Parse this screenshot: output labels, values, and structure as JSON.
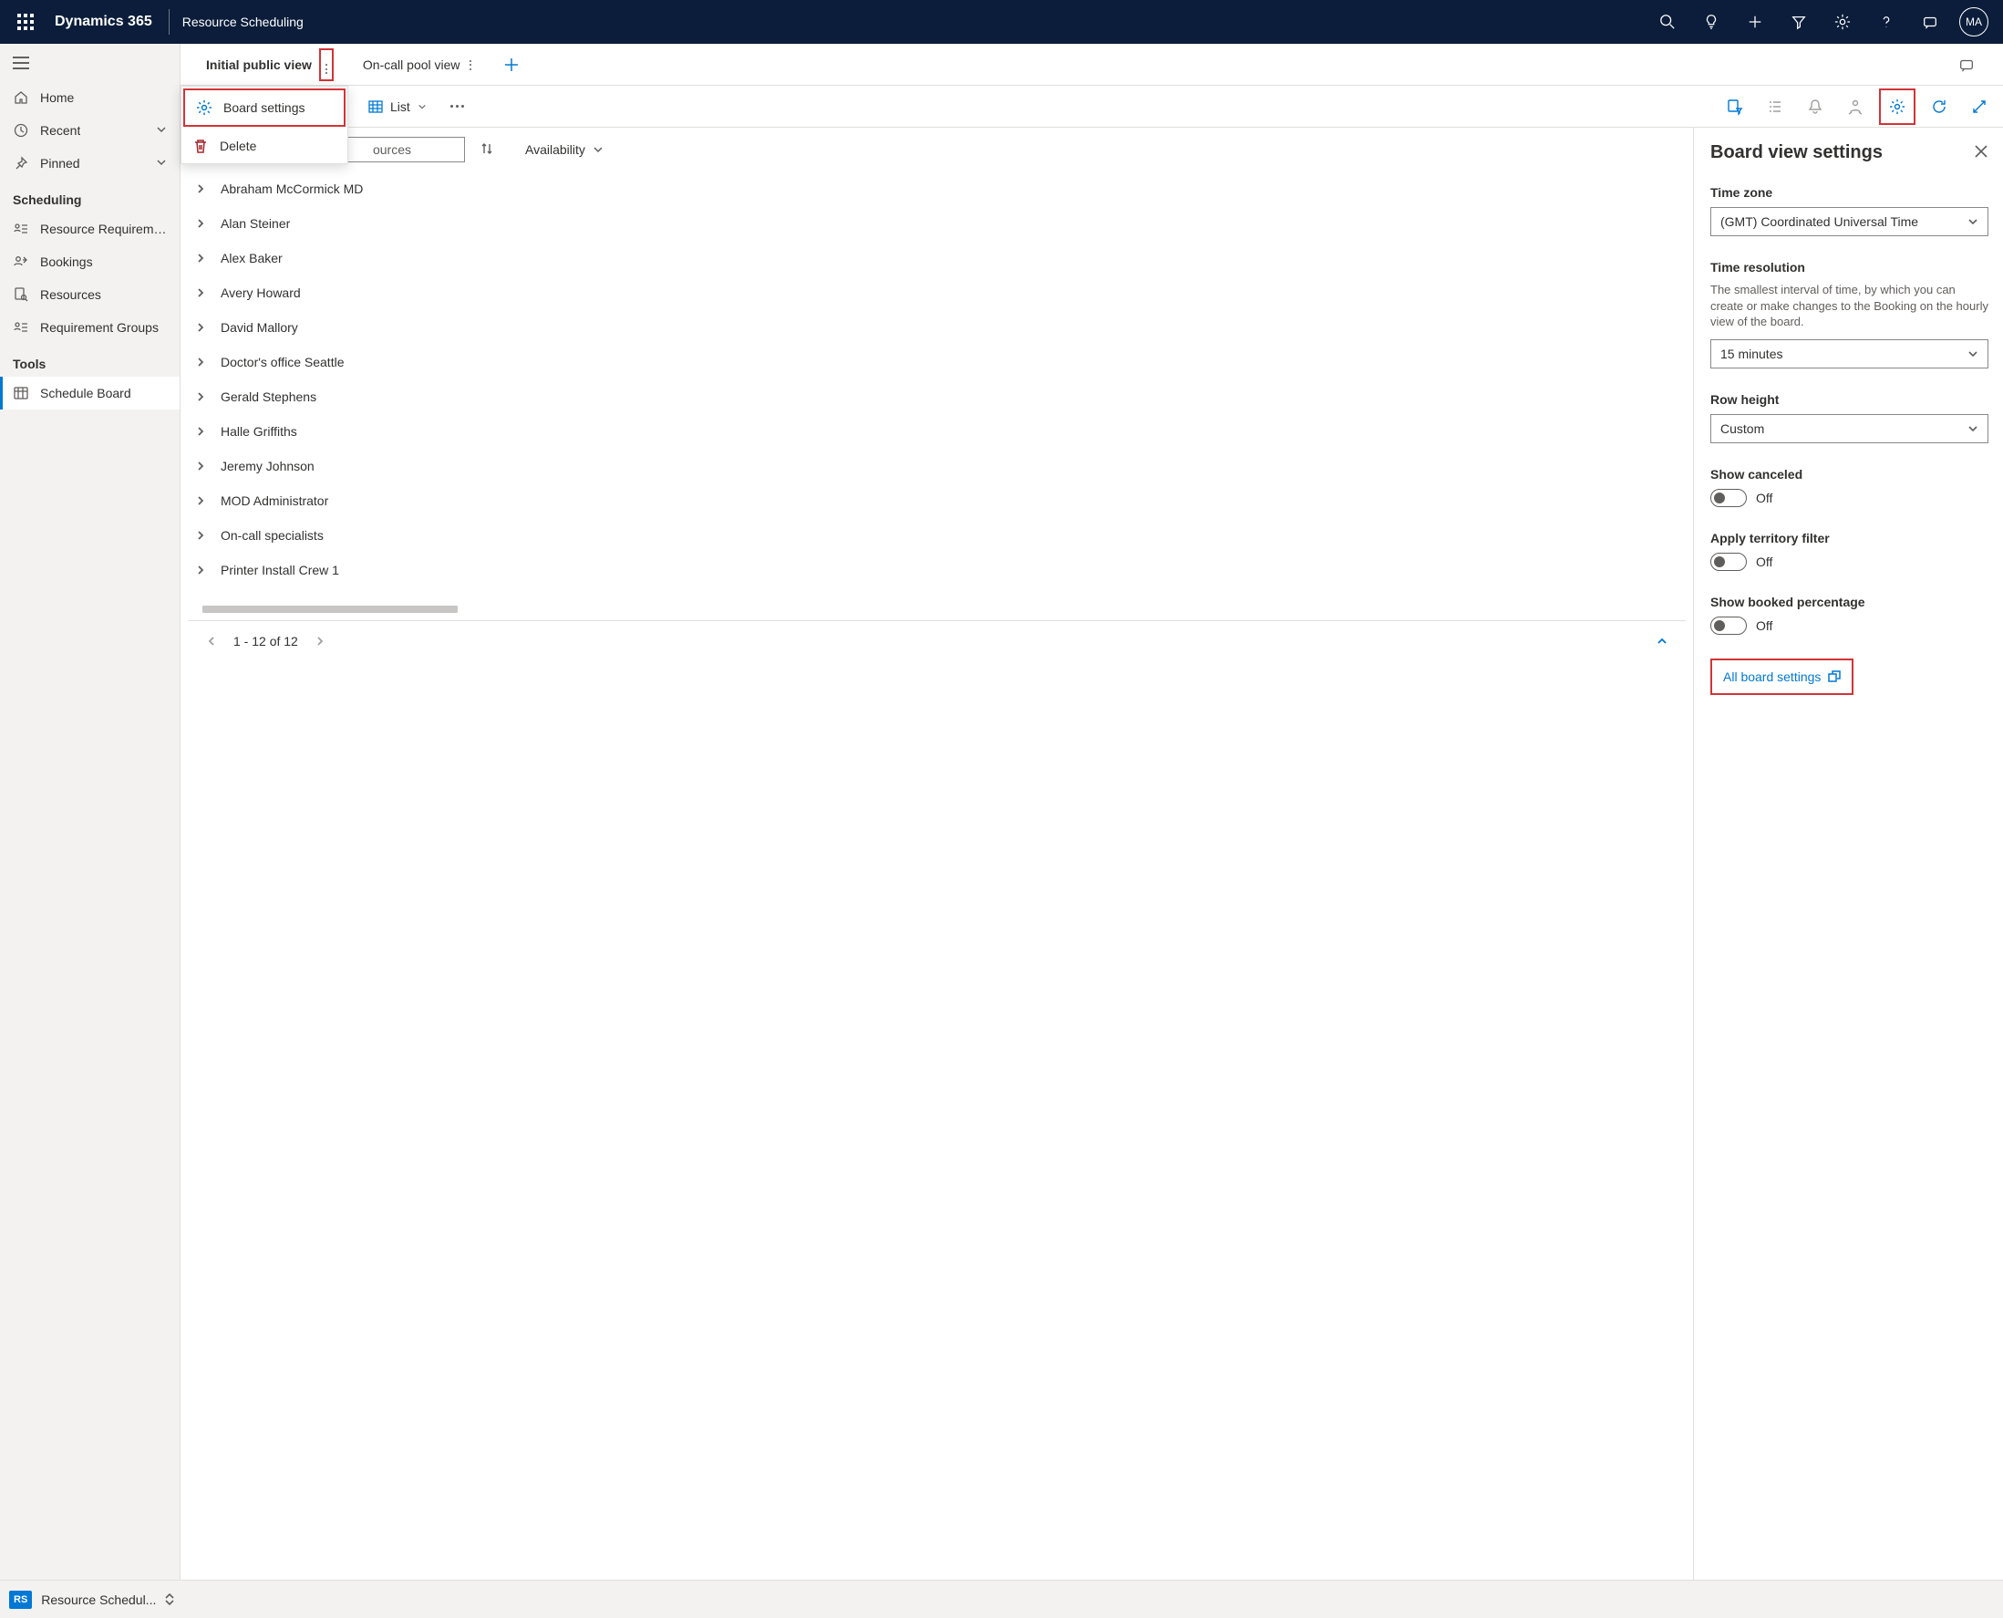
{
  "header": {
    "product": "Dynamics 365",
    "app": "Resource Scheduling",
    "avatar": "MA"
  },
  "left_nav": {
    "items_top": [
      {
        "label": "Home",
        "icon": "home"
      },
      {
        "label": "Recent",
        "icon": "clock",
        "chevron": true
      },
      {
        "label": "Pinned",
        "icon": "pin",
        "chevron": true
      }
    ],
    "groups": [
      {
        "label": "Scheduling",
        "items": [
          {
            "label": "Resource Requireme...",
            "icon": "people-list"
          },
          {
            "label": "Bookings",
            "icon": "people-arrow"
          },
          {
            "label": "Resources",
            "icon": "page-search"
          },
          {
            "label": "Requirement Groups",
            "icon": "people-list"
          }
        ]
      },
      {
        "label": "Tools",
        "items": [
          {
            "label": "Schedule Board",
            "icon": "calendar-grid",
            "active": true
          }
        ]
      }
    ]
  },
  "tabs": {
    "items": [
      {
        "label": "Initial public view",
        "active": true,
        "more_red": true
      },
      {
        "label": "On-call pool view",
        "active": false
      }
    ]
  },
  "context_menu": {
    "board_settings": "Board settings",
    "delete": "Delete"
  },
  "toolbar": {
    "view_label": "List",
    "search_fragment": "ources",
    "availability": "Availability"
  },
  "resources": [
    "Abraham McCormick MD",
    "Alan Steiner",
    "Alex Baker",
    "Avery Howard",
    "David Mallory",
    "Doctor's office Seattle",
    "Gerald Stephens",
    "Halle Griffiths",
    "Jeremy Johnson",
    "MOD Administrator",
    "On-call specialists",
    "Printer Install Crew 1"
  ],
  "settings_panel": {
    "title": "Board view settings",
    "timezone": {
      "label": "Time zone",
      "value": "(GMT) Coordinated Universal Time"
    },
    "time_resolution": {
      "label": "Time resolution",
      "help": "The smallest interval of time, by which you can create or make changes to the Booking on the hourly view of the board.",
      "value": "15 minutes"
    },
    "row_height": {
      "label": "Row height",
      "value": "Custom"
    },
    "show_canceled": {
      "label": "Show canceled",
      "state": "Off"
    },
    "territory_filter": {
      "label": "Apply territory filter",
      "state": "Off"
    },
    "booked_pct": {
      "label": "Show booked percentage",
      "state": "Off"
    },
    "all_board": "All board settings"
  },
  "pager": {
    "text": "1 - 12 of 12"
  },
  "bottom": {
    "badge": "RS",
    "label": "Resource Schedul..."
  }
}
